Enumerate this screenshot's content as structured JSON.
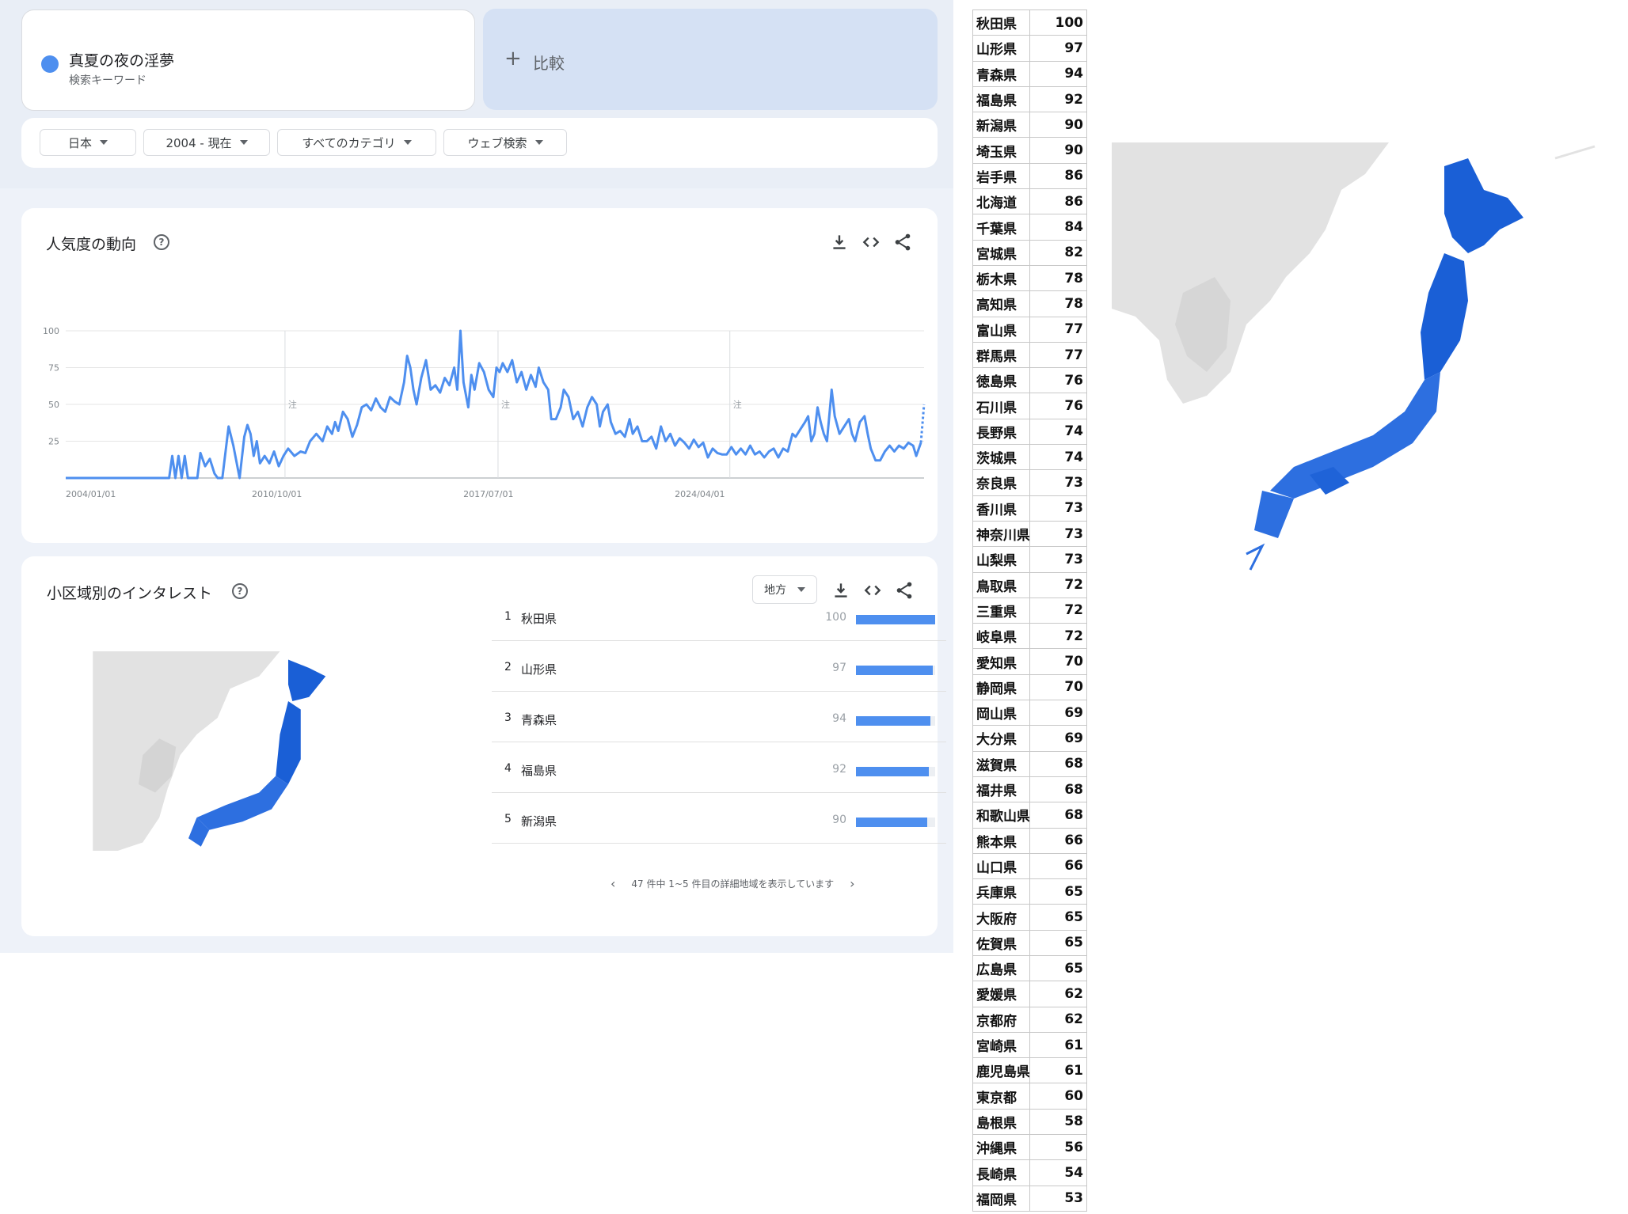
{
  "keyword": {
    "title": "真夏の夜の淫夢",
    "subtitle": "検索キーワード",
    "color": "#4e8fef"
  },
  "compare": {
    "icon": "plus-icon",
    "label": "比較"
  },
  "filters": [
    {
      "label": "日本"
    },
    {
      "label": "2004 - 現在"
    },
    {
      "label": "すべてのカテゴリ"
    },
    {
      "label": "ウェブ検索"
    }
  ],
  "trend": {
    "title": "人気度の動向",
    "help": "?",
    "chart_data": {
      "type": "line",
      "x_tick_labels": [
        "2004/01/01",
        "2010/10/01",
        "2017/07/01",
        "2024/04/01"
      ],
      "y_tick_labels": [
        "100",
        "75",
        "50",
        "25"
      ],
      "ylim": [
        0,
        100
      ],
      "annotation_marker": "注",
      "annotation_years": [
        2011.0,
        2017.8,
        2025.2
      ],
      "grid": true,
      "series": [
        {
          "color": "#4e8fef",
          "points": [
            [
              2004.0,
              0
            ],
            [
              2005.0,
              0
            ],
            [
              2006.0,
              0
            ],
            [
              2007.0,
              0
            ],
            [
              2007.3,
              0
            ],
            [
              2007.4,
              15
            ],
            [
              2007.5,
              0
            ],
            [
              2007.6,
              15
            ],
            [
              2007.7,
              0
            ],
            [
              2007.8,
              15
            ],
            [
              2007.9,
              0
            ],
            [
              2008.2,
              0
            ],
            [
              2008.3,
              17
            ],
            [
              2008.45,
              8
            ],
            [
              2008.6,
              13
            ],
            [
              2008.75,
              3
            ],
            [
              2008.85,
              0
            ],
            [
              2009.0,
              0
            ],
            [
              2009.2,
              35
            ],
            [
              2009.35,
              22
            ],
            [
              2009.55,
              0
            ],
            [
              2009.7,
              28
            ],
            [
              2009.8,
              36
            ],
            [
              2009.9,
              30
            ],
            [
              2010.0,
              15
            ],
            [
              2010.1,
              25
            ],
            [
              2010.2,
              10
            ],
            [
              2010.35,
              15
            ],
            [
              2010.5,
              10
            ],
            [
              2010.65,
              18
            ],
            [
              2010.8,
              8
            ],
            [
              2010.95,
              15
            ],
            [
              2011.1,
              20
            ],
            [
              2011.3,
              15
            ],
            [
              2011.5,
              18
            ],
            [
              2011.65,
              17
            ],
            [
              2011.8,
              25
            ],
            [
              2012.0,
              30
            ],
            [
              2012.2,
              25
            ],
            [
              2012.35,
              35
            ],
            [
              2012.5,
              30
            ],
            [
              2012.6,
              38
            ],
            [
              2012.7,
              32
            ],
            [
              2012.85,
              45
            ],
            [
              2013.0,
              40
            ],
            [
              2013.15,
              28
            ],
            [
              2013.3,
              36
            ],
            [
              2013.45,
              48
            ],
            [
              2013.6,
              50
            ],
            [
              2013.75,
              46
            ],
            [
              2013.9,
              54
            ],
            [
              2014.05,
              48
            ],
            [
              2014.2,
              45
            ],
            [
              2014.35,
              55
            ],
            [
              2014.5,
              52
            ],
            [
              2014.65,
              50
            ],
            [
              2014.8,
              65
            ],
            [
              2014.9,
              83
            ],
            [
              2015.0,
              75
            ],
            [
              2015.1,
              60
            ],
            [
              2015.2,
              50
            ],
            [
              2015.35,
              68
            ],
            [
              2015.5,
              80
            ],
            [
              2015.65,
              60
            ],
            [
              2015.8,
              63
            ],
            [
              2015.95,
              58
            ],
            [
              2016.1,
              68
            ],
            [
              2016.25,
              63
            ],
            [
              2016.4,
              75
            ],
            [
              2016.5,
              60
            ],
            [
              2016.6,
              100
            ],
            [
              2016.7,
              65
            ],
            [
              2016.85,
              48
            ],
            [
              2016.95,
              70
            ],
            [
              2017.05,
              60
            ],
            [
              2017.2,
              78
            ],
            [
              2017.35,
              72
            ],
            [
              2017.5,
              60
            ],
            [
              2017.65,
              55
            ],
            [
              2017.75,
              75
            ],
            [
              2017.85,
              72
            ],
            [
              2017.95,
              78
            ],
            [
              2018.1,
              72
            ],
            [
              2018.25,
              80
            ],
            [
              2018.4,
              65
            ],
            [
              2018.55,
              72
            ],
            [
              2018.7,
              60
            ],
            [
              2018.85,
              70
            ],
            [
              2019.0,
              62
            ],
            [
              2019.1,
              75
            ],
            [
              2019.25,
              65
            ],
            [
              2019.4,
              60
            ],
            [
              2019.5,
              40
            ],
            [
              2019.65,
              40
            ],
            [
              2019.8,
              48
            ],
            [
              2019.9,
              60
            ],
            [
              2020.05,
              55
            ],
            [
              2020.2,
              40
            ],
            [
              2020.35,
              45
            ],
            [
              2020.5,
              35
            ],
            [
              2020.65,
              48
            ],
            [
              2020.8,
              55
            ],
            [
              2020.95,
              50
            ],
            [
              2021.05,
              35
            ],
            [
              2021.15,
              45
            ],
            [
              2021.3,
              50
            ],
            [
              2021.4,
              38
            ],
            [
              2021.55,
              30
            ],
            [
              2021.7,
              32
            ],
            [
              2021.85,
              28
            ],
            [
              2022.0,
              40
            ],
            [
              2022.1,
              30
            ],
            [
              2022.25,
              35
            ],
            [
              2022.4,
              25
            ],
            [
              2022.55,
              25
            ],
            [
              2022.7,
              28
            ],
            [
              2022.85,
              20
            ],
            [
              2023.0,
              35
            ],
            [
              2023.15,
              25
            ],
            [
              2023.3,
              30
            ],
            [
              2023.45,
              22
            ],
            [
              2023.6,
              27
            ],
            [
              2023.75,
              24
            ],
            [
              2023.9,
              20
            ],
            [
              2024.05,
              26
            ],
            [
              2024.2,
              21
            ],
            [
              2024.35,
              24
            ],
            [
              2024.5,
              14
            ],
            [
              2024.65,
              20
            ],
            [
              2024.8,
              17
            ],
            [
              2024.95,
              16
            ],
            [
              2025.1,
              16
            ],
            [
              2025.25,
              21
            ],
            [
              2025.4,
              16
            ],
            [
              2025.55,
              20
            ],
            [
              2025.7,
              16
            ],
            [
              2025.85,
              22
            ],
            [
              2026.0,
              16
            ],
            [
              2026.15,
              18
            ],
            [
              2026.3,
              14
            ],
            [
              2026.45,
              18
            ],
            [
              2026.6,
              20
            ],
            [
              2026.75,
              14
            ],
            [
              2026.9,
              20
            ],
            [
              2027.05,
              18
            ],
            [
              2027.2,
              30
            ],
            [
              2027.3,
              28
            ],
            [
              2027.45,
              33
            ],
            [
              2027.6,
              38
            ],
            [
              2027.7,
              42
            ],
            [
              2027.8,
              25
            ],
            [
              2027.9,
              30
            ],
            [
              2028.0,
              48
            ],
            [
              2028.1,
              38
            ],
            [
              2028.2,
              30
            ],
            [
              2028.3,
              25
            ],
            [
              2028.45,
              60
            ],
            [
              2028.55,
              42
            ],
            [
              2028.7,
              30
            ],
            [
              2028.85,
              35
            ],
            [
              2029.0,
              40
            ],
            [
              2029.1,
              30
            ],
            [
              2029.2,
              25
            ],
            [
              2029.35,
              38
            ],
            [
              2029.5,
              42
            ],
            [
              2029.6,
              30
            ],
            [
              2029.7,
              20
            ],
            [
              2029.85,
              12
            ],
            [
              2030.0,
              12
            ],
            [
              2030.15,
              18
            ],
            [
              2030.3,
              22
            ],
            [
              2030.45,
              18
            ],
            [
              2030.6,
              22
            ],
            [
              2030.75,
              20
            ],
            [
              2030.9,
              24
            ],
            [
              2031.05,
              22
            ],
            [
              2031.15,
              15
            ],
            [
              2031.3,
              24
            ]
          ],
          "partial_points": [
            [
              2031.3,
              24
            ],
            [
              2031.4,
              50
            ]
          ]
        }
      ]
    }
  },
  "interest": {
    "title": "小区域別のインタレスト",
    "help": "?",
    "region_select": "地方",
    "rows": [
      {
        "rank": "1",
        "name": "秋田県",
        "value": "100",
        "fill": 1.0
      },
      {
        "rank": "2",
        "name": "山形県",
        "value": "97",
        "fill": 0.97
      },
      {
        "rank": "3",
        "name": "青森県",
        "value": "94",
        "fill": 0.94
      },
      {
        "rank": "4",
        "name": "福島県",
        "value": "92",
        "fill": 0.92
      },
      {
        "rank": "5",
        "name": "新潟県",
        "value": "90",
        "fill": 0.9
      }
    ],
    "pager": "47 件中 1~5 件目の詳細地域を表示しています"
  },
  "table": [
    [
      "秋田県",
      "100"
    ],
    [
      "山形県",
      "97"
    ],
    [
      "青森県",
      "94"
    ],
    [
      "福島県",
      "92"
    ],
    [
      "新潟県",
      "90"
    ],
    [
      "埼玉県",
      "90"
    ],
    [
      "岩手県",
      "86"
    ],
    [
      "北海道",
      "86"
    ],
    [
      "千葉県",
      "84"
    ],
    [
      "宮城県",
      "82"
    ],
    [
      "栃木県",
      "78"
    ],
    [
      "高知県",
      "78"
    ],
    [
      "富山県",
      "77"
    ],
    [
      "群馬県",
      "77"
    ],
    [
      "徳島県",
      "76"
    ],
    [
      "石川県",
      "76"
    ],
    [
      "長野県",
      "74"
    ],
    [
      "茨城県",
      "74"
    ],
    [
      "奈良県",
      "73"
    ],
    [
      "香川県",
      "73"
    ],
    [
      "神奈川県",
      "73"
    ],
    [
      "山梨県",
      "73"
    ],
    [
      "鳥取県",
      "72"
    ],
    [
      "三重県",
      "72"
    ],
    [
      "岐阜県",
      "72"
    ],
    [
      "愛知県",
      "70"
    ],
    [
      "静岡県",
      "70"
    ],
    [
      "岡山県",
      "69"
    ],
    [
      "大分県",
      "69"
    ],
    [
      "滋賀県",
      "68"
    ],
    [
      "福井県",
      "68"
    ],
    [
      "和歌山県",
      "68"
    ],
    [
      "熊本県",
      "66"
    ],
    [
      "山口県",
      "66"
    ],
    [
      "兵庫県",
      "65"
    ],
    [
      "大阪府",
      "65"
    ],
    [
      "佐賀県",
      "65"
    ],
    [
      "広島県",
      "65"
    ],
    [
      "愛媛県",
      "62"
    ],
    [
      "京都府",
      "62"
    ],
    [
      "宮崎県",
      "61"
    ],
    [
      "鹿児島県",
      "61"
    ],
    [
      "東京都",
      "60"
    ],
    [
      "島根県",
      "58"
    ],
    [
      "沖縄県",
      "56"
    ],
    [
      "長崎県",
      "54"
    ],
    [
      "福岡県",
      "53"
    ]
  ],
  "colors": {
    "accent": "#4e8fef",
    "map_dark": "#1a5fd6",
    "map_mid": "#2d6fe0",
    "land": "#e2e2e2"
  }
}
